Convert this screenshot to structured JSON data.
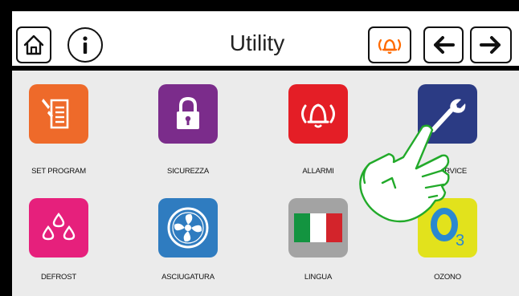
{
  "header": {
    "title": "Utility",
    "buttons": {
      "home": "home-icon",
      "info": "info-icon",
      "alarm": "alarm-bell-icon",
      "back": "arrow-left-icon",
      "forward": "arrow-right-icon"
    }
  },
  "menu": {
    "items": [
      {
        "label": "SET PROGRAM",
        "icon": "set-program-icon",
        "color": "#ee6a2a"
      },
      {
        "label": "SICUREZZA",
        "icon": "lock-icon",
        "color": "#7b2c8b"
      },
      {
        "label": "ALLARMI",
        "icon": "alarm-bell-icon",
        "color": "#e41e26"
      },
      {
        "label": "SERVICE",
        "icon": "wrench-icon",
        "color": "#2b3b84"
      },
      {
        "label": "DEFROST",
        "icon": "water-drops-icon",
        "color": "#e6207c"
      },
      {
        "label": "ASCIUGATURA",
        "icon": "fan-icon",
        "color": "#2f7cc0"
      },
      {
        "label": "LINGUA",
        "icon": "italy-flag-icon",
        "color": "#a3a3a3"
      },
      {
        "label": "OZONO",
        "icon": "ozone-icon",
        "color": "#e2e21c"
      }
    ]
  },
  "colors": {
    "alarm_accent": "#ff6a00",
    "hand_green": "#22aa2a",
    "background": "#ebebeb"
  },
  "overlay": {
    "icon": "tap-hand-icon"
  }
}
